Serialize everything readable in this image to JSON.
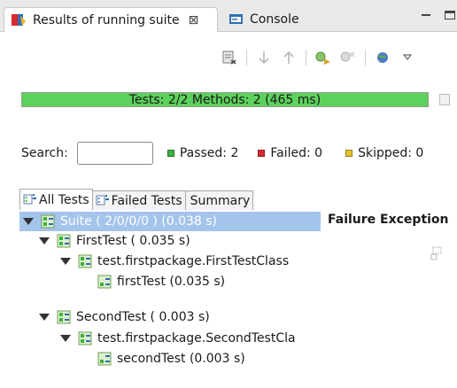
{
  "tabs": {
    "results_label": "Results of running suite",
    "close_glyph": "⊠",
    "console_label": "Console"
  },
  "progress": {
    "text": "Tests: 2/2  Methods: 2 (465 ms)",
    "fraction": 1.0,
    "color": "#5cd15c"
  },
  "search": {
    "label": "Search:",
    "value": ""
  },
  "stats": {
    "passed": "Passed: 2",
    "failed": "Failed: 0",
    "skipped": "Skipped: 0"
  },
  "subtabs": {
    "all": "All Tests",
    "failed": "Failed Tests",
    "summary": "Summary"
  },
  "failure_header": "Failure Exception",
  "tree": [
    {
      "label": "Suite ( 2/0/0/0 ) (0.038 s)",
      "expanded": true
    },
    {
      "label": "FirstTest ( 0.035 s)",
      "expanded": true
    },
    {
      "label": "test.firstpackage.FirstTestClass",
      "expanded": true
    },
    {
      "label": "firstTest  (0.035 s)"
    },
    {
      "label": "SecondTest ( 0.003 s)",
      "expanded": true
    },
    {
      "label": "test.firstpackage.SecondTestCla",
      "expanded": true
    },
    {
      "label": "secondTest  (0.003 s)"
    }
  ],
  "colors": {
    "passed": "#3cb43c",
    "failed": "#d9272e",
    "skipped": "#e6c42e",
    "selected_row": "#a3c4eb"
  }
}
